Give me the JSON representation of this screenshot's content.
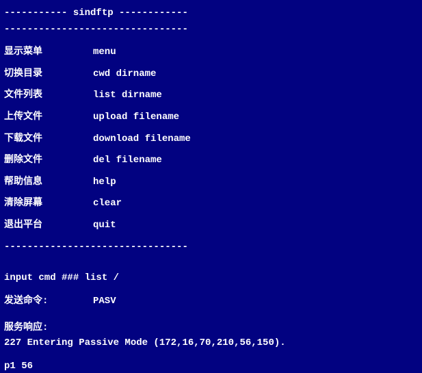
{
  "header": {
    "title_line": "----------- sindftp ------------",
    "separator": "--------------------------------"
  },
  "menu": [
    {
      "label": "显示菜单",
      "cmd": "menu"
    },
    {
      "label": "切换目录",
      "cmd": "cwd dirname"
    },
    {
      "label": "文件列表",
      "cmd": "list dirname"
    },
    {
      "label": "上传文件",
      "cmd": "upload filename"
    },
    {
      "label": "下载文件",
      "cmd": "download filename"
    },
    {
      "label": "删除文件",
      "cmd": "del filename"
    },
    {
      "label": "帮助信息",
      "cmd": "help"
    },
    {
      "label": "清除屏幕",
      "cmd": "clear"
    },
    {
      "label": "退出平台",
      "cmd": "quit"
    }
  ],
  "separator2": "--------------------------------",
  "input_prompt": "input cmd ### list /",
  "send": {
    "label": "发送命令:",
    "cmd": "PASV"
  },
  "response": {
    "label": "服务响应:",
    "text": "227 Entering Passive Mode (172,16,70,210,56,150)."
  },
  "footer": "p1 56"
}
